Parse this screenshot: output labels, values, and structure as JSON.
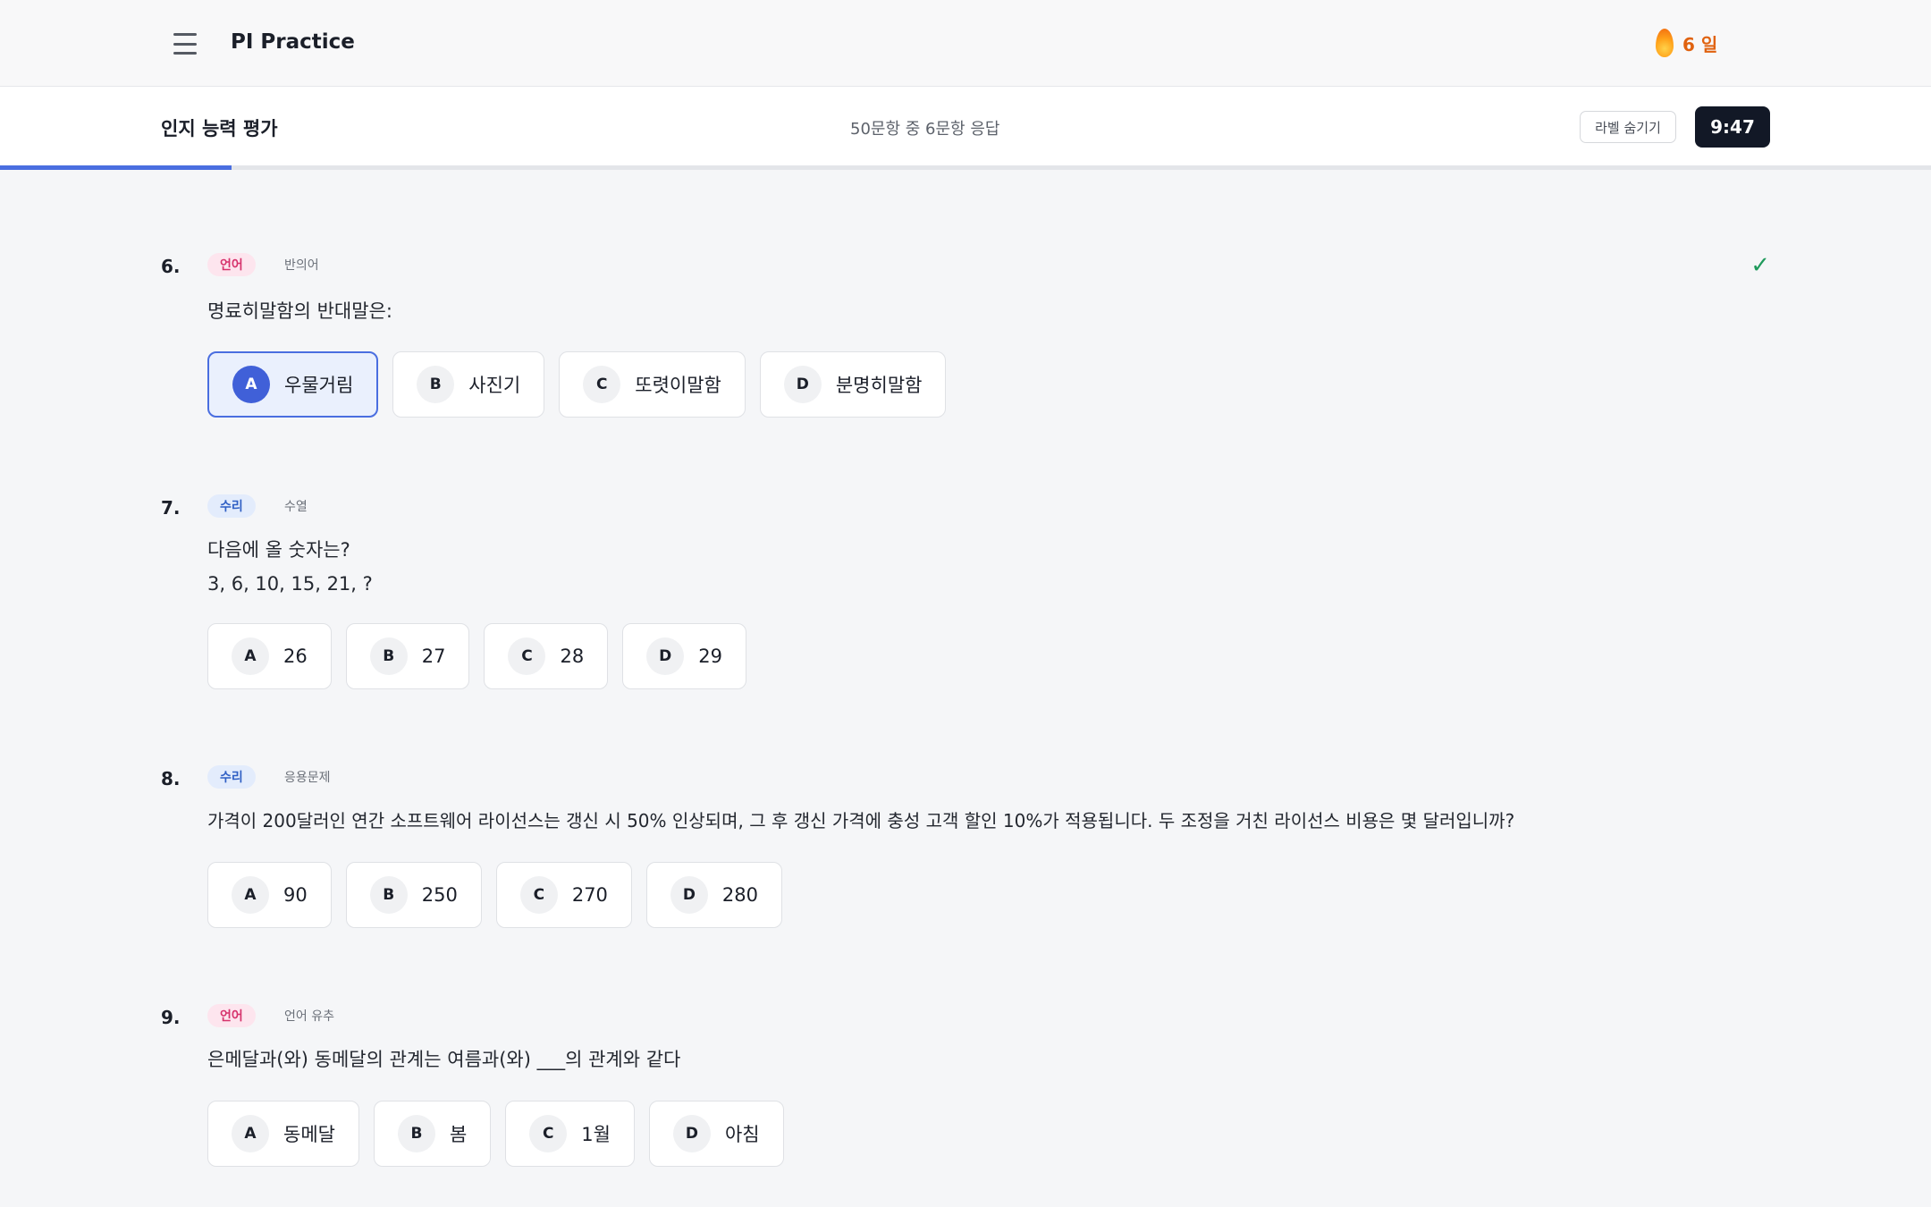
{
  "app": {
    "title": "PI Practice",
    "streak": "6 일"
  },
  "test": {
    "title": "인지 능력 평가",
    "progress_text": "50문항 중 6문항 응답",
    "answered": 6,
    "total": 50,
    "hide_labels": "라벨 숨기기",
    "timer": "9:47"
  },
  "questions": [
    {
      "number": "6.",
      "category": "언어",
      "subcategory": "반의어",
      "text_lines": [
        "명료히말함의 반대말은:"
      ],
      "answered": true,
      "selected": "A",
      "options": [
        {
          "letter": "A",
          "text": "우물거림"
        },
        {
          "letter": "B",
          "text": "사진기"
        },
        {
          "letter": "C",
          "text": "또렷이말함"
        },
        {
          "letter": "D",
          "text": "분명히말함"
        }
      ]
    },
    {
      "number": "7.",
      "category": "수리",
      "subcategory": "수열",
      "text_lines": [
        "다음에 올 숫자는?",
        "3, 6, 10, 15, 21, ?"
      ],
      "options": [
        {
          "letter": "A",
          "text": "26"
        },
        {
          "letter": "B",
          "text": "27"
        },
        {
          "letter": "C",
          "text": "28"
        },
        {
          "letter": "D",
          "text": "29"
        }
      ]
    },
    {
      "number": "8.",
      "category": "수리",
      "subcategory": "응용문제",
      "text_lines": [
        "가격이 200달러인 연간 소프트웨어 라이선스는 갱신 시 50% 인상되며, 그 후 갱신 가격에 충성 고객 할인 10%가 적용됩니다. 두 조정을 거친 라이선스 비용은 몇 달러입니까?"
      ],
      "options": [
        {
          "letter": "A",
          "text": "90"
        },
        {
          "letter": "B",
          "text": "250"
        },
        {
          "letter": "C",
          "text": "270"
        },
        {
          "letter": "D",
          "text": "280"
        }
      ]
    },
    {
      "number": "9.",
      "category": "언어",
      "subcategory": "언어 유추",
      "text_lines": [
        "은메달과(와) 동메달의 관계는 여름과(와) ___의 관계와 같다"
      ],
      "options": [
        {
          "letter": "A",
          "text": "동메달"
        },
        {
          "letter": "B",
          "text": "봄"
        },
        {
          "letter": "C",
          "text": "1월"
        },
        {
          "letter": "D",
          "text": "아침"
        }
      ]
    }
  ],
  "colors": {
    "accent": "#4a6ee0",
    "lang_tag_bg": "#fde5ee",
    "lang_tag_fg": "#d6336c",
    "math_tag_bg": "#e3ecfc",
    "math_tag_fg": "#2f5fc4",
    "check": "#1f9a5c",
    "timer_bg": "#121826",
    "streak": "#e0620f"
  },
  "icons": [
    "menu-icon",
    "flame-icon",
    "check-icon"
  ]
}
